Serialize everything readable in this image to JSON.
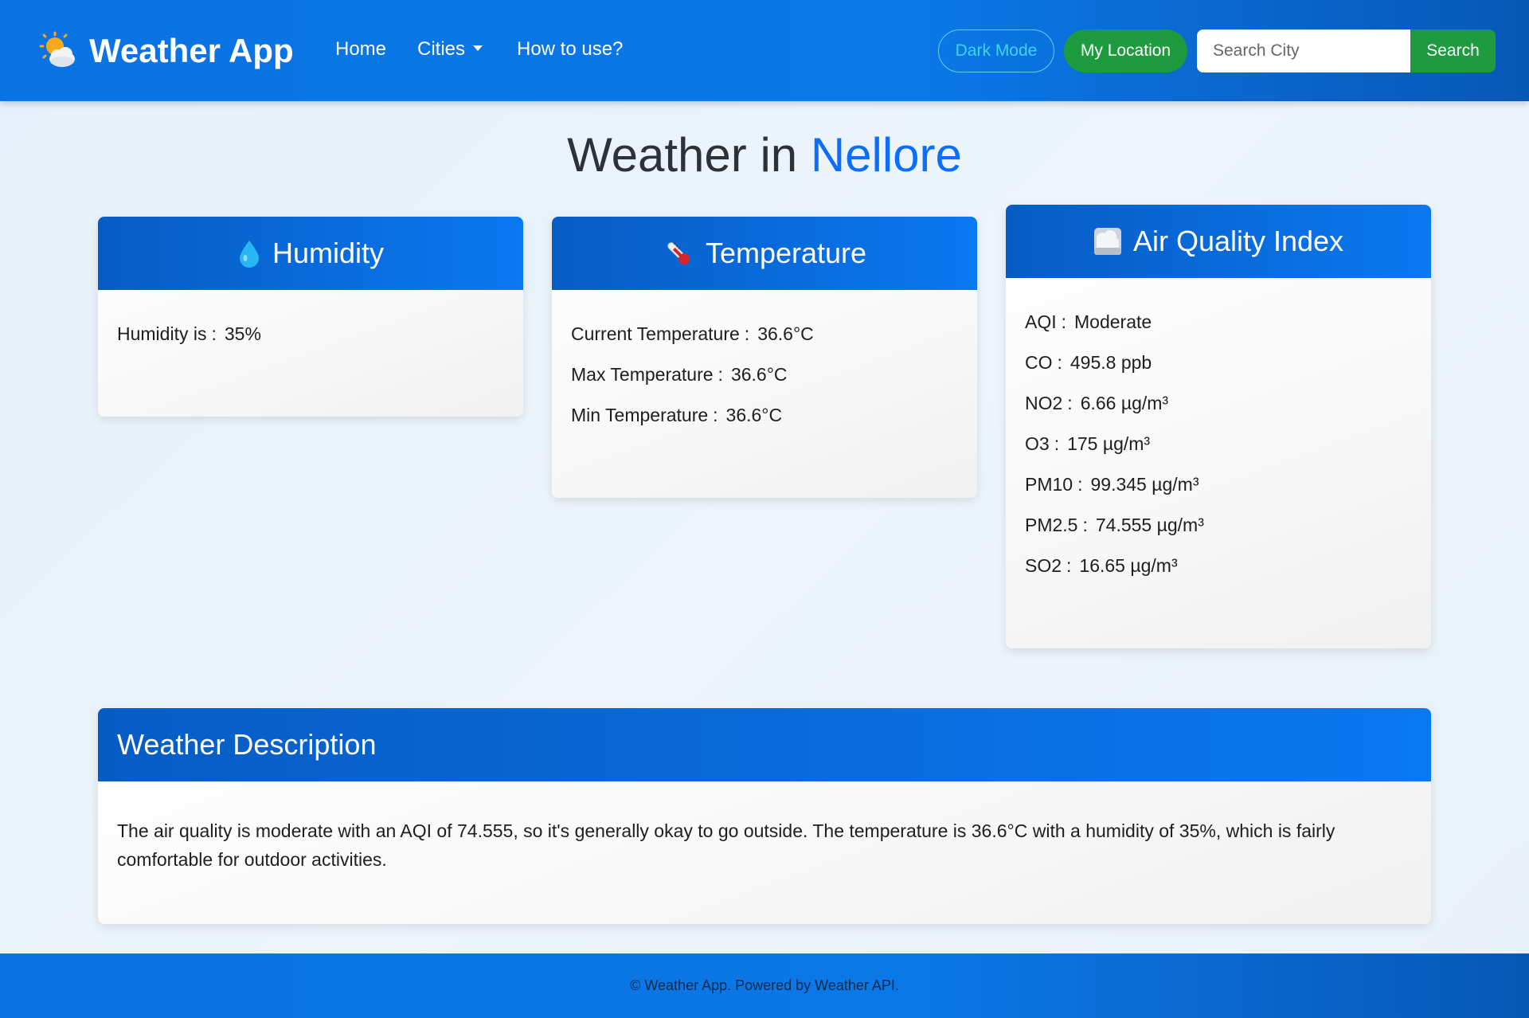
{
  "navbar": {
    "brand": "Weather App",
    "brand_icon": "sun-behind-cloud-icon",
    "links": {
      "home": "Home",
      "cities": "Cities",
      "how_to_use": "How to use?"
    },
    "dark_mode_label": "Dark Mode",
    "my_location_label": "My Location",
    "search_placeholder": "Search City",
    "search_value": "",
    "search_button": "Search"
  },
  "title": {
    "prefix": "Weather in",
    "city": "Nellore"
  },
  "humidity": {
    "title": "Humidity",
    "icon": "droplet-icon",
    "label": "Humidity is",
    "value": "35%"
  },
  "temperature": {
    "title": "Temperature",
    "icon": "thermometer-icon",
    "rows": [
      {
        "label": "Current Temperature",
        "value": "36.6°C"
      },
      {
        "label": "Max Temperature",
        "value": "36.6°C"
      },
      {
        "label": "Min Temperature",
        "value": "36.6°C"
      }
    ]
  },
  "aqi": {
    "title": "Air Quality Index",
    "icon": "fog-icon",
    "rows": [
      {
        "label": "AQI",
        "value": "Moderate"
      },
      {
        "label": "CO",
        "value": "495.8 ppb"
      },
      {
        "label": "NO2",
        "value": "6.66 µg/m³"
      },
      {
        "label": "O3",
        "value": "175 µg/m³"
      },
      {
        "label": "PM10",
        "value": "99.345 µg/m³"
      },
      {
        "label": "PM2.5",
        "value": "74.555 µg/m³"
      },
      {
        "label": "SO2",
        "value": "16.65 µg/m³"
      }
    ]
  },
  "description": {
    "title": "Weather Description",
    "text": "The air quality is moderate with an AQI of 74.555, so it's generally okay to go outside. The temperature is 36.6°C with a humidity of 35%, which is fairly comfortable for outdoor activities."
  },
  "footer": {
    "text": "© Weather App. Powered by Weather API."
  },
  "colors": {
    "primary": "#0b78e8",
    "accent_blue": "#0d6efd",
    "green": "#1f9b3f",
    "cyan": "#3fd3f5"
  }
}
